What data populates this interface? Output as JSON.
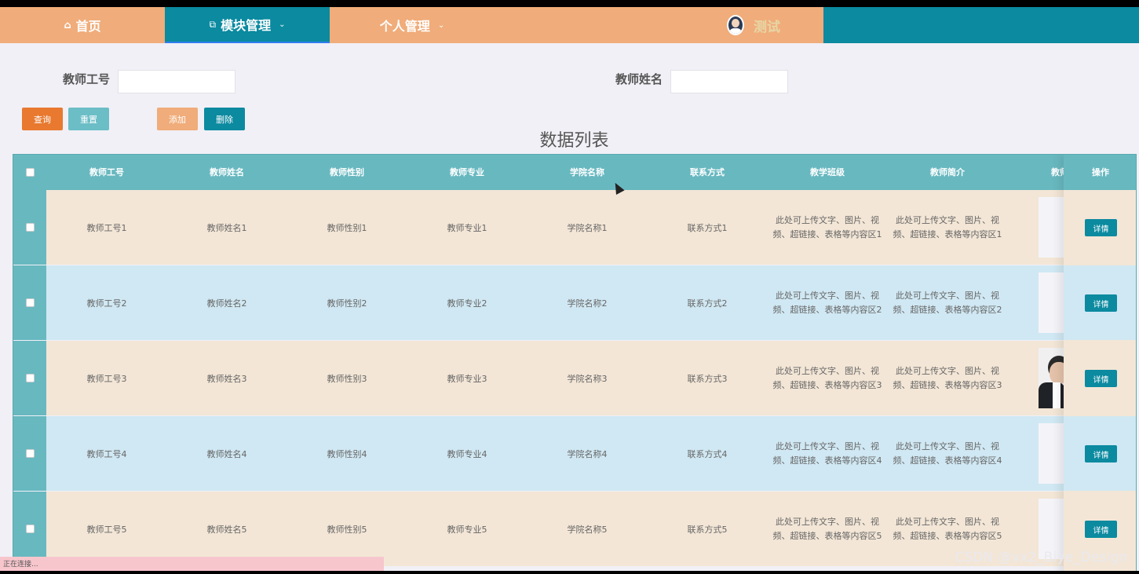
{
  "nav": {
    "home": "首页",
    "module": "模块管理",
    "personal": "个人管理",
    "username": "测试"
  },
  "search": {
    "teacher_id_label": "教师工号",
    "teacher_id_value": "",
    "teacher_name_label": "教师姓名",
    "teacher_name_value": ""
  },
  "buttons": {
    "query": "查询",
    "reset": "重置",
    "add": "添加",
    "delete": "删除"
  },
  "list_title": "数据列表",
  "table": {
    "headers": [
      "教师工号",
      "教师姓名",
      "教师性别",
      "教师专业",
      "学院名称",
      "联系方式",
      "教学班级",
      "教师简介",
      "教师",
      "操作"
    ],
    "rows": [
      {
        "id": "教师工号1",
        "name": "教师姓名1",
        "gender": "教师性别1",
        "major": "教师专业1",
        "college": "学院名称1",
        "contact": "联系方式1",
        "class_l1": "此处可上传文字、图片、视",
        "class_l2": "频、超链接、表格等内容区1",
        "intro_l1": "此处可上传文字、图片、视",
        "intro_l2": "频、超链接、表格等内容区1",
        "detail": "详情"
      },
      {
        "id": "教师工号2",
        "name": "教师姓名2",
        "gender": "教师性别2",
        "major": "教师专业2",
        "college": "学院名称2",
        "contact": "联系方式2",
        "class_l1": "此处可上传文字、图片、视",
        "class_l2": "频、超链接、表格等内容区2",
        "intro_l1": "此处可上传文字、图片、视",
        "intro_l2": "频、超链接、表格等内容区2",
        "detail": "详情"
      },
      {
        "id": "教师工号3",
        "name": "教师姓名3",
        "gender": "教师性别3",
        "major": "教师专业3",
        "college": "学院名称3",
        "contact": "联系方式3",
        "class_l1": "此处可上传文字、图片、视",
        "class_l2": "频、超链接、表格等内容区3",
        "intro_l1": "此处可上传文字、图片、视",
        "intro_l2": "频、超链接、表格等内容区3",
        "detail": "详情"
      },
      {
        "id": "教师工号4",
        "name": "教师姓名4",
        "gender": "教师性别4",
        "major": "教师专业4",
        "college": "学院名称4",
        "contact": "联系方式4",
        "class_l1": "此处可上传文字、图片、视",
        "class_l2": "频、超链接、表格等内容区4",
        "intro_l1": "此处可上传文字、图片、视",
        "intro_l2": "频、超链接、表格等内容区4",
        "detail": "详情"
      },
      {
        "id": "教师工号5",
        "name": "教师姓名5",
        "gender": "教师性别5",
        "major": "教师专业5",
        "college": "学院名称5",
        "contact": "联系方式5",
        "class_l1": "此处可上传文字、图片、视",
        "class_l2": "频、超链接、表格等内容区5",
        "intro_l1": "此处可上传文字、图片、视",
        "intro_l2": "频、超链接、表格等内容区5",
        "detail": "详情"
      }
    ]
  },
  "status_text": "正在连接...",
  "watermark": "CSDN @vx2_Biye_Design",
  "colors": {
    "nav_orange": "#f0ac7a",
    "nav_teal": "#0b8aa0",
    "header_teal": "#68b8c0",
    "row_beige": "#f3e6d6",
    "row_blue": "#d0e8f3",
    "query_btn": "#e8792f",
    "reset_btn": "#6cbec6",
    "add_btn": "#f0ac7a",
    "delete_btn": "#0b8aa0"
  }
}
